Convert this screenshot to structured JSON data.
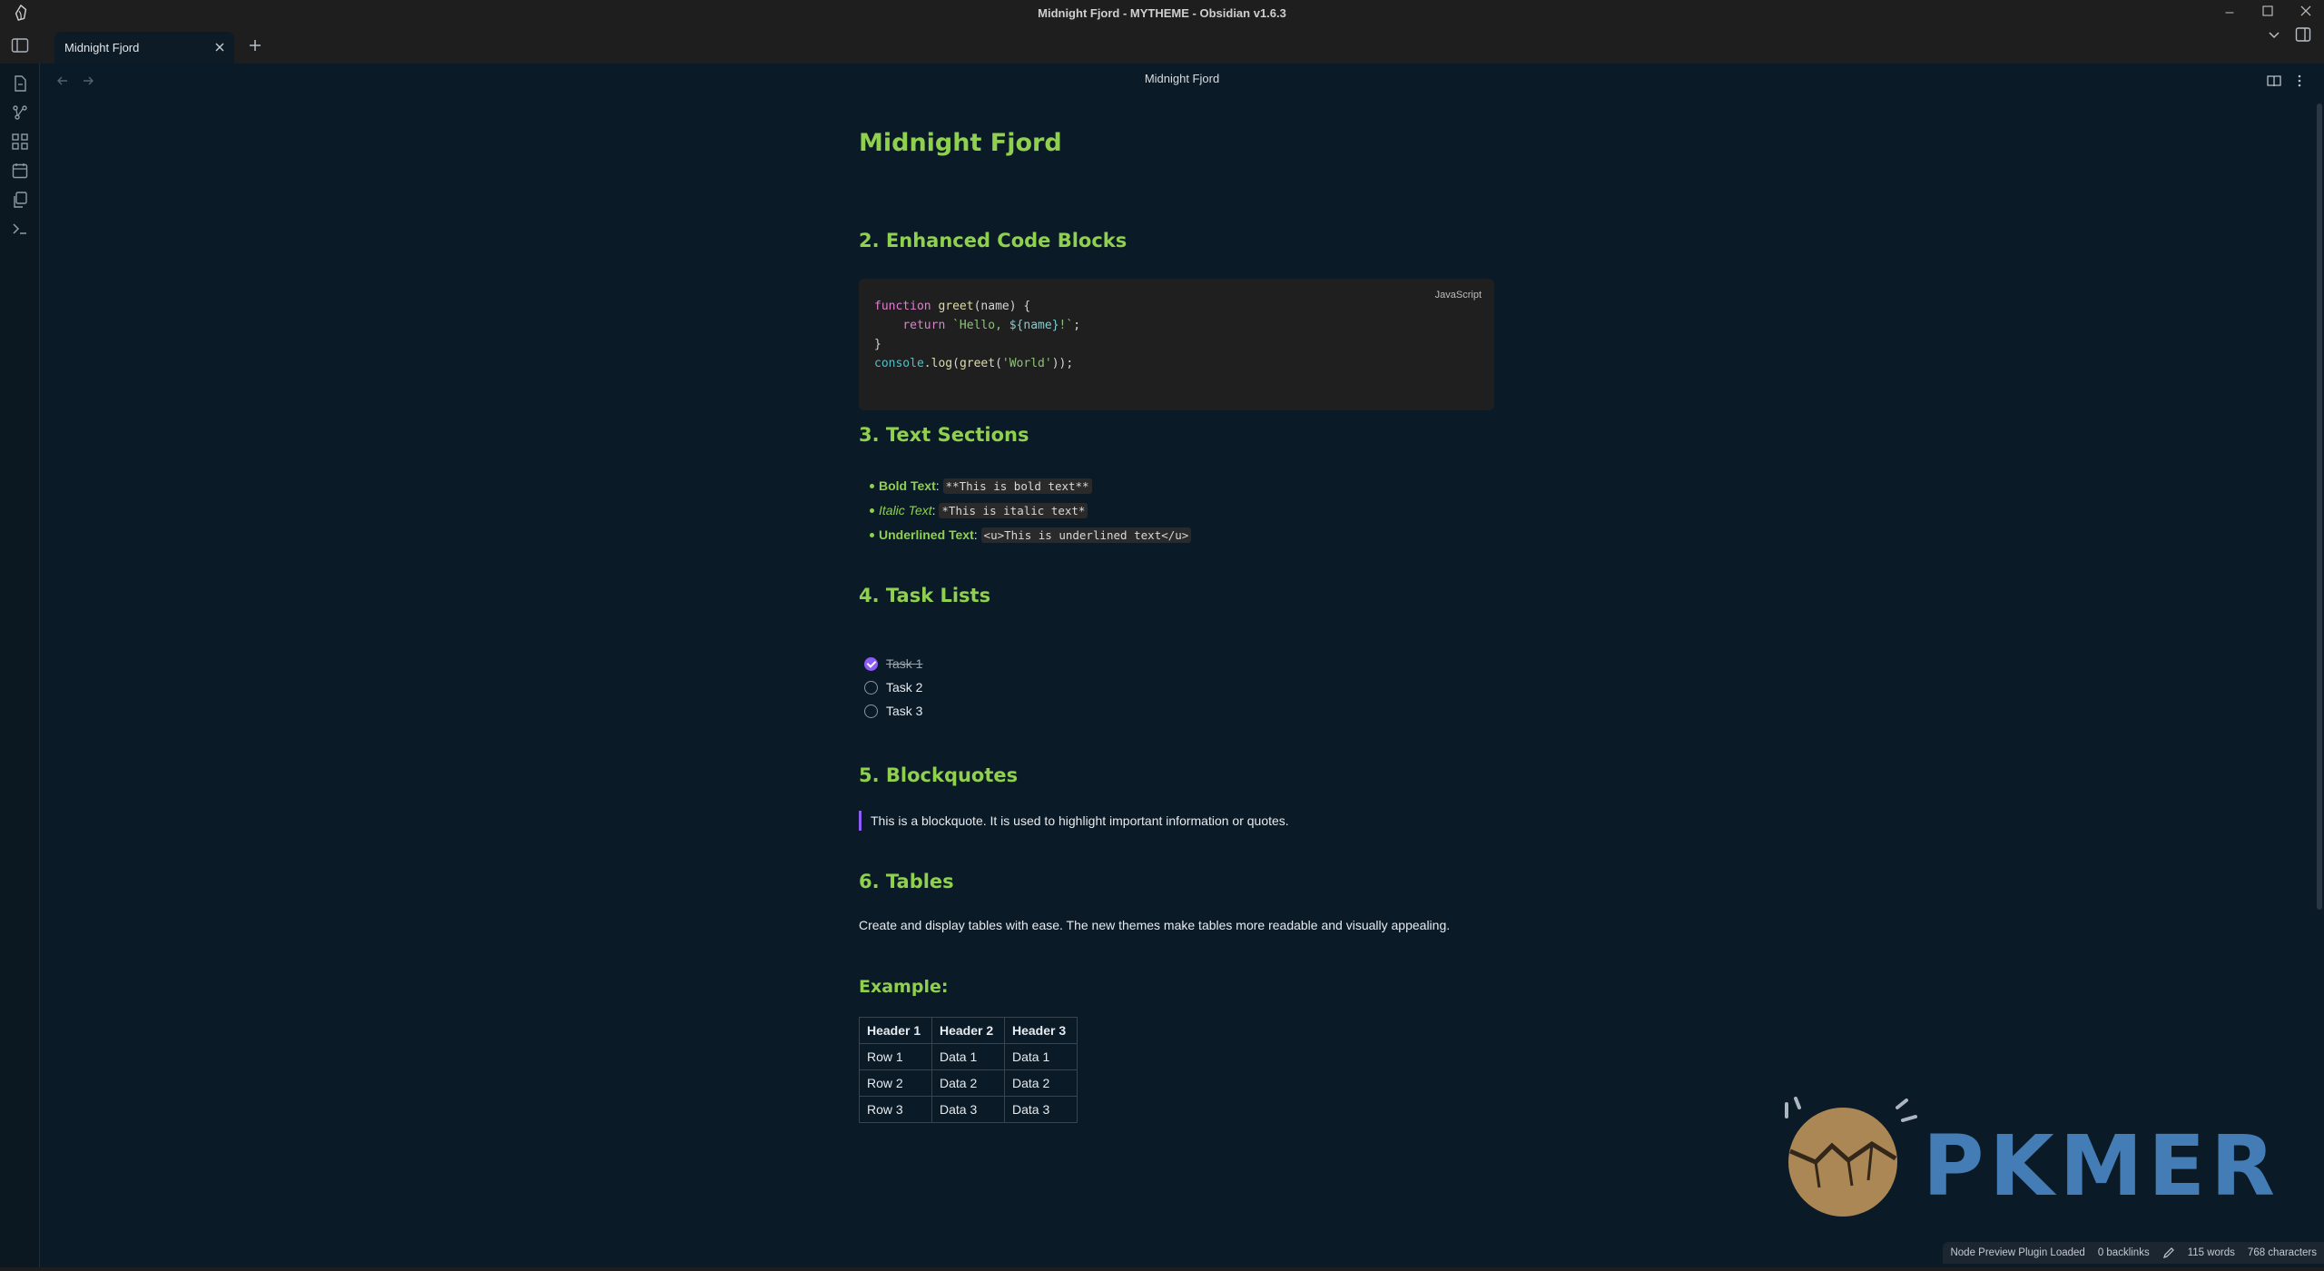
{
  "window": {
    "title": "Midnight Fjord - MYTHEME - Obsidian v1.6.3"
  },
  "tabs": {
    "active_tab_label": "Midnight Fjord"
  },
  "view": {
    "title": "Midnight Fjord"
  },
  "note": {
    "title": "Midnight Fjord",
    "sections": {
      "code_heading": "2. Enhanced Code Blocks",
      "text_heading": "3. Text Sections",
      "tasks_heading": "4. Task Lists",
      "quote_heading": "5. Blockquotes",
      "tables_heading": "6. Tables"
    },
    "code": {
      "language": "JavaScript",
      "lines": [
        "function greet(name) {",
        "    return `Hello, ${name}!`;",
        "}",
        "console.log(greet('World'));"
      ]
    },
    "text_items": [
      {
        "label": "Bold Text",
        "sep": ": ",
        "code": "**This is bold text**"
      },
      {
        "label": "Italic Text",
        "sep": ": ",
        "code": "*This is italic text*"
      },
      {
        "label": "Underlined Text",
        "sep": ": ",
        "code": "<u>This is underlined text</u>"
      }
    ],
    "tasks": [
      {
        "label": "Task 1",
        "done": true
      },
      {
        "label": "Task 2",
        "done": false
      },
      {
        "label": "Task 3",
        "done": false
      }
    ],
    "blockquote": "This is a blockquote. It is used to highlight important information or quotes.",
    "tables_paragraph": "Create and display tables with ease. The new themes make tables more readable and visually appealing.",
    "example_heading": "Example:",
    "table": {
      "headers": [
        "Header 1",
        "Header 2",
        "Header 3"
      ],
      "rows": [
        [
          "Row 1",
          "Data 1",
          "Data 1"
        ],
        [
          "Row 2",
          "Data 2",
          "Data 2"
        ],
        [
          "Row 3",
          "Data 3",
          "Data 3"
        ]
      ]
    }
  },
  "watermark": {
    "text": "PKMER"
  },
  "statusbar": {
    "plugin_status": "Node Preview Plugin Loaded",
    "backlinks": "0 backlinks",
    "words": "115 words",
    "characters": "768 characters"
  },
  "colors": {
    "heading": "#8fd14f",
    "accent": "#8b5cf6",
    "background": "#0b1a27",
    "code_background": "#1f1f1f"
  },
  "icons": {
    "ribbon": [
      "file-icon",
      "graph-icon",
      "grid-icon",
      "calendar-icon",
      "copy-icon",
      "terminal-icon"
    ]
  }
}
